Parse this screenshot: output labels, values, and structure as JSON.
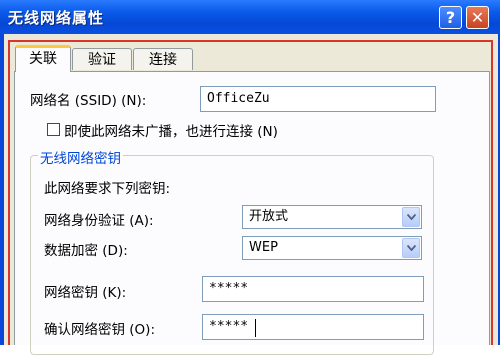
{
  "window": {
    "title": "无线网络属性",
    "help_glyph": "?",
    "close_glyph": "✕"
  },
  "tabs": [
    {
      "label": "关联",
      "active": true
    },
    {
      "label": "验证",
      "active": false
    },
    {
      "label": "连接",
      "active": false
    }
  ],
  "association": {
    "ssid_label": "网络名 (SSID) (N):",
    "ssid_value": "OfficeZu",
    "broadcast_label": "即使此网络未广播，也进行连接 (N)",
    "broadcast_checked": false,
    "group_title": "无线网络密钥",
    "group_intro": "此网络要求下列密钥:",
    "auth_label": "网络身份验证 (A):",
    "auth_value": "开放式",
    "encryption_label": "数据加密 (D):",
    "encryption_value": "WEP",
    "key_label": "网络密钥 (K):",
    "key_value": "*****",
    "confirm_label": "确认网络密钥 (O):",
    "confirm_value": "*****"
  },
  "colors": {
    "titlebar": "#0A4FE0",
    "dialog_bg": "#ECE9D8",
    "group_title": "#0046D5",
    "highlight_frame": "#D9352B"
  }
}
